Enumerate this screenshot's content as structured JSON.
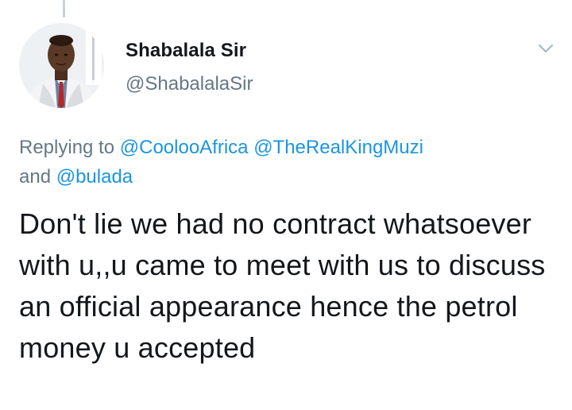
{
  "tweet": {
    "author": {
      "display_name": "Shabalala Sir",
      "handle": "@ShabalalaSir",
      "avatar": "user-profile-photo"
    },
    "menu_icon": "chevron-down-icon",
    "reply_context": {
      "prefix": "Replying to",
      "mentions": [
        "@CoolooAfrica",
        "@TheRealKingMuzi",
        "@bulada"
      ],
      "conjunction": "and"
    },
    "text": "Don't lie we had no contract whatsoever with u,,u came to meet with us to discuss an official appearance hence the petrol money u accepted"
  },
  "colors": {
    "text_primary": "#14171a",
    "text_secondary": "#657786",
    "link": "#1b95e0",
    "thread_line": "#c8d1d9"
  }
}
